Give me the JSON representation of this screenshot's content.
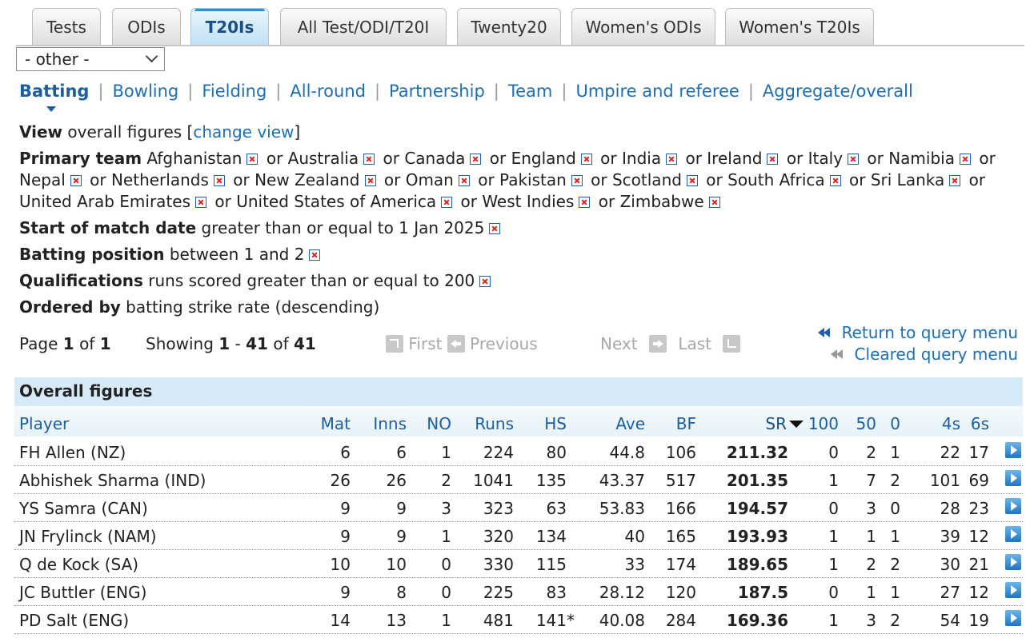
{
  "tabs": [
    "Tests",
    "ODIs",
    "T20Is",
    "All Test/ODI/T20I",
    "Twenty20",
    "Women's ODIs",
    "Women's T20Is"
  ],
  "active_tab": "T20Is",
  "select": {
    "value": "- other -"
  },
  "subnav": [
    "Batting",
    "Bowling",
    "Fielding",
    "All-round",
    "Partnership",
    "Team",
    "Umpire and referee",
    "Aggregate/overall"
  ],
  "filters": {
    "view_label": "View",
    "view_value": "overall figures",
    "change_view": "change view",
    "primary_label": "Primary team",
    "teams": [
      "Afghanistan",
      "Australia",
      "Canada",
      "England",
      "India",
      "Ireland",
      "Italy",
      "Namibia",
      "Nepal",
      "Netherlands",
      "New Zealand",
      "Oman",
      "Pakistan",
      "Scotland",
      "South Africa",
      "Sri Lanka",
      "United Arab Emirates",
      "United States of America",
      "West Indies",
      "Zimbabwe"
    ],
    "or_word": "or",
    "date_label": "Start of match date",
    "date_value": "greater than or equal to 1 Jan 2025",
    "position_label": "Batting position",
    "position_value": "between 1 and 2",
    "qual_label": "Qualifications",
    "qual_value": "runs scored greater than or equal to 200",
    "order_label": "Ordered by",
    "order_value": "batting strike rate (descending)"
  },
  "pager": {
    "page_word": "Page",
    "page": "1",
    "of_word": "of",
    "pages": "1",
    "showing_word": "Showing",
    "from": "1",
    "dash": "-",
    "to": "41",
    "total": "41",
    "first": "First",
    "previous": "Previous",
    "next": "Next",
    "last": "Last",
    "return_query": "Return to query menu",
    "cleared_query": "Cleared query menu"
  },
  "table": {
    "title": "Overall figures",
    "columns": [
      "Player",
      "Mat",
      "Inns",
      "NO",
      "Runs",
      "HS",
      "Ave",
      "BF",
      "SR",
      "100",
      "50",
      "0",
      "4s",
      "6s"
    ],
    "rows": [
      [
        "FH Allen (NZ)",
        "6",
        "6",
        "1",
        "224",
        "80",
        "44.8",
        "106",
        "211.32",
        "0",
        "2",
        "1",
        "22",
        "17"
      ],
      [
        "Abhishek Sharma (IND)",
        "26",
        "26",
        "2",
        "1041",
        "135",
        "43.37",
        "517",
        "201.35",
        "1",
        "7",
        "2",
        "101",
        "69"
      ],
      [
        "YS Samra (CAN)",
        "9",
        "9",
        "3",
        "323",
        "63",
        "53.83",
        "166",
        "194.57",
        "0",
        "3",
        "0",
        "28",
        "23"
      ],
      [
        "JN Frylinck (NAM)",
        "9",
        "9",
        "1",
        "320",
        "134",
        "40",
        "165",
        "193.93",
        "1",
        "1",
        "1",
        "39",
        "12"
      ],
      [
        "Q de Kock (SA)",
        "10",
        "10",
        "0",
        "330",
        "115",
        "33",
        "174",
        "189.65",
        "1",
        "2",
        "2",
        "30",
        "21"
      ],
      [
        "JC Buttler (ENG)",
        "9",
        "8",
        "0",
        "225",
        "83",
        "28.12",
        "120",
        "187.5",
        "0",
        "1",
        "1",
        "27",
        "12"
      ],
      [
        "PD Salt (ENG)",
        "14",
        "13",
        "1",
        "481",
        "141*",
        "40.08",
        "284",
        "169.36",
        "1",
        "3",
        "2",
        "54",
        "19"
      ]
    ]
  }
}
